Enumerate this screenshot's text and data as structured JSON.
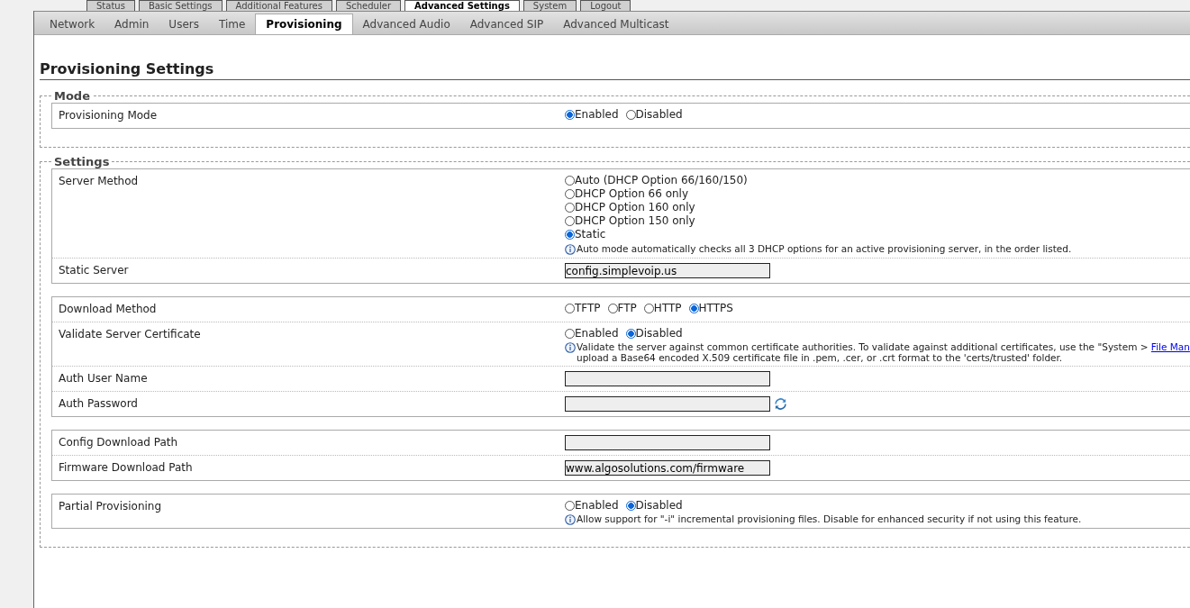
{
  "top_tabs": [
    {
      "label": "Status",
      "selected": false
    },
    {
      "label": "Basic Settings",
      "selected": false
    },
    {
      "label": "Additional Features",
      "selected": false
    },
    {
      "label": "Scheduler",
      "selected": false
    },
    {
      "label": "Advanced Settings",
      "selected": true
    },
    {
      "label": "System",
      "selected": false
    },
    {
      "label": "Logout",
      "selected": false
    }
  ],
  "sub_tabs": [
    {
      "label": "Network",
      "selected": false
    },
    {
      "label": "Admin",
      "selected": false
    },
    {
      "label": "Users",
      "selected": false
    },
    {
      "label": "Time",
      "selected": false
    },
    {
      "label": "Provisioning",
      "selected": true
    },
    {
      "label": "Advanced Audio",
      "selected": false
    },
    {
      "label": "Advanced SIP",
      "selected": false
    },
    {
      "label": "Advanced Multicast",
      "selected": false
    }
  ],
  "heading": "Provisioning Settings",
  "sections": [
    {
      "legend": "Mode",
      "groups": [
        [
          {
            "label": "Provisioning Mode",
            "kind": "radio",
            "stacked": false,
            "options": [
              {
                "label": "Enabled",
                "selected": true
              },
              {
                "label": "Disabled",
                "selected": false
              }
            ]
          }
        ]
      ]
    },
    {
      "legend": "Settings",
      "groups": [
        [
          {
            "label": "Server Method",
            "kind": "radio",
            "stacked": true,
            "options": [
              {
                "label": "Auto (DHCP Option 66/160/150)",
                "selected": false
              },
              {
                "label": "DHCP Option 66 only",
                "selected": false
              },
              {
                "label": "DHCP Option 160 only",
                "selected": false
              },
              {
                "label": "DHCP Option 150 only",
                "selected": false
              },
              {
                "label": "Static",
                "selected": true
              }
            ],
            "info": {
              "text": "Auto mode automatically checks all 3 DHCP options for an active provisioning server, in the order listed."
            }
          },
          {
            "label": "Static Server",
            "kind": "text",
            "value": "config.simplevoip.us"
          }
        ],
        [
          {
            "label": "Download Method",
            "kind": "radio",
            "stacked": false,
            "options": [
              {
                "label": "TFTP",
                "selected": false
              },
              {
                "label": "FTP",
                "selected": false
              },
              {
                "label": "HTTP",
                "selected": false
              },
              {
                "label": "HTTPS",
                "selected": true
              }
            ]
          },
          {
            "label": "Validate Server Certificate",
            "kind": "radio",
            "stacked": false,
            "options": [
              {
                "label": "Enabled",
                "selected": false
              },
              {
                "label": "Disabled",
                "selected": true
              }
            ],
            "info": {
              "text": "Validate the server against common certificate authorities. To validate against additional certificates, use the \"System > ",
              "link": "File Man",
              "text2": "upload a Base64 encoded X.509 certificate file in .pem, .cer, or .crt format to the 'certs/trusted' folder."
            }
          },
          {
            "label": "Auth User Name",
            "kind": "text"
          },
          {
            "label": "Auth Password",
            "kind": "password"
          }
        ],
        [
          {
            "label": "Config Download Path",
            "kind": "text"
          },
          {
            "label": "Firmware Download Path",
            "kind": "text",
            "value": "www.algosolutions.com/firmware"
          }
        ],
        [
          {
            "label": "Partial Provisioning",
            "kind": "radio",
            "stacked": false,
            "options": [
              {
                "label": "Enabled",
                "selected": false
              },
              {
                "label": "Disabled",
                "selected": true
              }
            ],
            "info": {
              "text": "Allow support for \"-i\" incremental provisioning files. Disable for enhanced security if not using this feature."
            }
          }
        ]
      ]
    }
  ]
}
